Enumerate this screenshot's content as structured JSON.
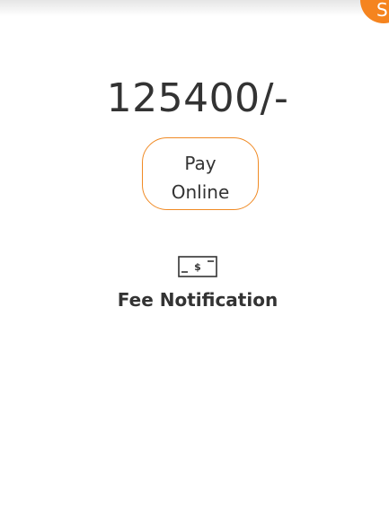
{
  "badge": {
    "letter": "S"
  },
  "fee": {
    "amount": "125400/-"
  },
  "pay_button": {
    "line1": "Pay",
    "line2": "Online"
  },
  "fee_notification": {
    "label": "Fee Notification",
    "icon": "money-bill-icon",
    "icon_symbol": "$"
  },
  "colors": {
    "accent": "#f5841f",
    "text": "#333333"
  }
}
